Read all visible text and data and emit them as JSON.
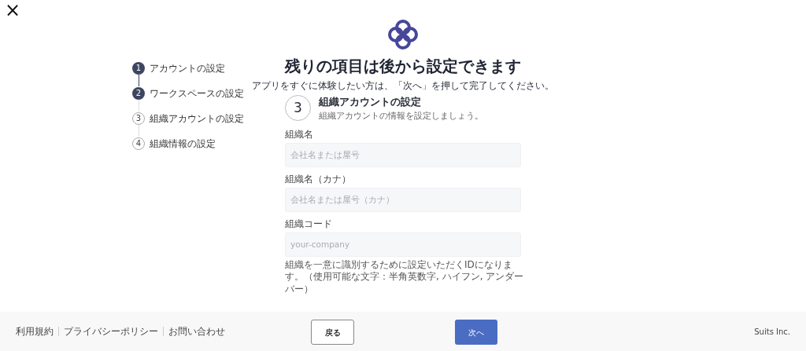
{
  "close_button": {
    "label": "×"
  },
  "steps": [
    {
      "number": "1",
      "label": "アカウントの設定",
      "done": true
    },
    {
      "number": "2",
      "label": "ワークスペースの設定",
      "done": true
    },
    {
      "number": "3",
      "label": "組織アカウントの設定",
      "done": false
    },
    {
      "number": "4",
      "label": "組織情報の設定",
      "done": false
    }
  ],
  "title": "残りの項目は後から設定できます",
  "subtitle": "アプリをすぐに体験したい方は、「次へ」を押して完了してください。",
  "section": {
    "number": "3",
    "heading": "組織アカウントの設定",
    "description": "組織アカウントの情報を設定しましょう。"
  },
  "fields": [
    {
      "label": "組織名",
      "placeholder": "会社名または屋号"
    },
    {
      "label": "組織名（カナ）",
      "placeholder": "会社名または屋号（カナ）"
    },
    {
      "label": "組織コード",
      "placeholder": "your-company",
      "hint": "組織を一意に識別するために設定いただくIDになります。（使用可能な文字：半角英数字, ハイフン, アンダーバー）"
    }
  ],
  "footer": {
    "links": [
      "利用規約",
      "プライバシーポリシー",
      "お問い合わせ"
    ],
    "back_button": "戻る",
    "next_button": "次へ",
    "company": "Suits Inc."
  }
}
